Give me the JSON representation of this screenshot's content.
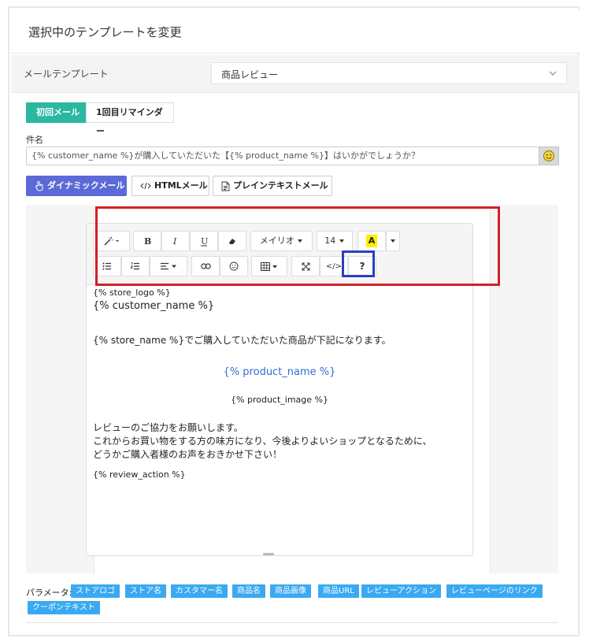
{
  "header": {
    "title": "選択中のテンプレートを変更"
  },
  "template_row": {
    "label": "メールテンプレート",
    "selected": "商品レビュー"
  },
  "tabs": [
    {
      "label": "初回メール",
      "active": true
    },
    {
      "label": "1回目リマインダー",
      "active": false
    }
  ],
  "subject": {
    "label": "件名",
    "value": "{% customer_name %}が購入していただいた【{% product_name %}】はいかがでしょうか？"
  },
  "modes": [
    {
      "label": "ダイナミックメール",
      "icon": "hand-pointer-icon",
      "active": true
    },
    {
      "label": "HTMLメール",
      "icon": "code-icon",
      "active": false
    },
    {
      "label": "プレインテキストメール",
      "icon": "document-icon",
      "active": false
    }
  ],
  "toolbar": {
    "font_name": "メイリオ",
    "font_size": "14",
    "highlight_letter": "A",
    "help": "?",
    "code_view": "</>"
  },
  "content": {
    "store_logo": "{% store_logo %}",
    "customer_name": "{% customer_name %}",
    "intro": "{% store_name %}でご購入していただいた商品が下記になります。",
    "product_name": "{% product_name %}",
    "product_image": "{% product_image %}",
    "body_1": "レビューのご協力をお願いします。",
    "body_2": "これからお買い物をする方の味方になり、今後よりよいショップとなるために、",
    "body_3": "どうかご購入者様のお声をおきかせ下さい！",
    "review_action": "{% review_action %}"
  },
  "params": {
    "label": "パラメータ:",
    "chips": [
      "ストアロゴ",
      "ストア名",
      "カスタマー名",
      "商品名",
      "商品画像",
      "商品URL",
      "レビューアクション",
      "レビューページのリンク",
      "クーポンテキスト"
    ]
  },
  "colors": {
    "tab_active": "#2bb8a1",
    "mode_active": "#5b6ad6",
    "chip": "#3aa9f2",
    "link": "#2f6fd0",
    "highlight": "#ffee00",
    "annotation_red": "#d11f2a",
    "annotation_blue": "#2a3fc2"
  }
}
